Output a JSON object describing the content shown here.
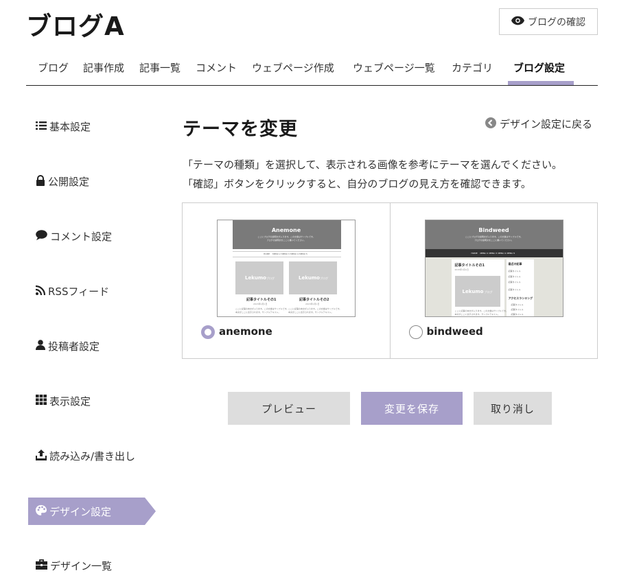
{
  "header": {
    "blog_title": "ブログA",
    "view_blog_label": "ブログの確認",
    "view_blog_icon": "eye-icon"
  },
  "nav": {
    "items": [
      {
        "label": "ブログ"
      },
      {
        "label": "記事作成"
      },
      {
        "label": "記事一覧"
      },
      {
        "label": "コメント"
      },
      {
        "label": "ウェブページ作成"
      },
      {
        "label": "ウェブページ一覧"
      },
      {
        "label": "カテゴリ"
      },
      {
        "label": "ブログ設定",
        "active": true
      }
    ]
  },
  "sidebar": {
    "items": [
      {
        "label": "基本設定",
        "icon": "list-icon"
      },
      {
        "label": "公開設定",
        "icon": "lock-icon"
      },
      {
        "label": "コメント設定",
        "icon": "comment-icon"
      },
      {
        "label": "RSSフィード",
        "icon": "rss-icon"
      },
      {
        "label": "投稿者設定",
        "icon": "user-icon"
      },
      {
        "label": "表示設定",
        "icon": "grid-icon"
      },
      {
        "label": "読み込み/書き出し",
        "icon": "upload-icon"
      },
      {
        "label": "デザイン設定",
        "icon": "palette-icon",
        "active": true
      },
      {
        "label": "デザイン一覧",
        "icon": "toolbox-icon"
      }
    ]
  },
  "main": {
    "title": "テーマを変更",
    "back_link": "デザイン設定に戻る",
    "description": [
      "「テーマの種類」を選択して、表示される画像を参考にテーマを選んでください。",
      "「確認」ボタンをクリックすると、自分のブログの見え方を確認できます。"
    ],
    "themes": [
      {
        "name": "anemone",
        "selected": true,
        "preview": {
          "title": "Anemone",
          "tagline_1": "ここにブログの説明文が入ります。この文章はサンプルです。",
          "tagline_2": "ブログの説明文をここに書いてください。",
          "menu": [
            "HOME",
            "MENU 2",
            "MENU 3",
            "MENU 4",
            "MENU 5"
          ],
          "image_text": "Lekumo",
          "image_sub": "ブログ",
          "post_title_1": "記事タイトルその1",
          "post_title_2": "記事タイトルその2",
          "post_date": "2015年1月1日",
          "body_1": "ここに記事の本文が入ります。この文章はサンプルです。",
          "body_2": "本文がここに表示されます。サンプルテキスト。"
        }
      },
      {
        "name": "bindweed",
        "selected": false,
        "preview": {
          "title": "Bindweed",
          "tagline_1": "ここにブログの説明文が入ります。この文章はサンプルです。",
          "tagline_2": "ブログの説明文をここに書いてください。",
          "menu": [
            "HOME",
            "MENU 2",
            "MENU 3",
            "MENU 4",
            "MENU 5"
          ],
          "image_text": "Lekumo",
          "image_sub": "ブログ",
          "post_title": "記事タイトルその1",
          "post_date": "2015年1月1日",
          "body_1": "ここに記事の本文が入ります。この文章はサンプルです。",
          "body_2": "本文がここに表示されます。サンプルテキスト。",
          "side_heading_1": "最近の記事",
          "side_links": [
            "記事タイトル",
            "記事タイトル",
            "記事タイトル",
            "記事タイトル"
          ],
          "side_heading_2": "アクセスランキング",
          "rank_items": [
            "記事タイトル",
            "記事タイトル",
            "記事タイトル"
          ]
        }
      }
    ]
  },
  "actions": {
    "preview": "プレビュー",
    "save": "変更を保存",
    "cancel": "取り消し"
  },
  "colors": {
    "accent": "#a79fca",
    "button_gray": "#dddddd",
    "text": "#222222"
  }
}
